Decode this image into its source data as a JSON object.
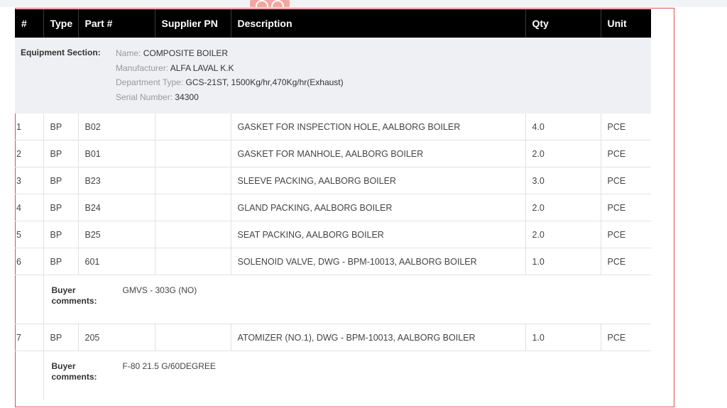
{
  "table": {
    "headers": [
      "#",
      "Type",
      "Part #",
      "Supplier PN",
      "Description",
      "Qty",
      "Unit"
    ],
    "equipment": {
      "label": "Equipment Section:",
      "name_key": "Name:",
      "name": "COMPOSITE BOILER",
      "manufacturer_key": "Manufacturer:",
      "manufacturer": "ALFA LAVAL K.K",
      "dept_key": "Department Type:",
      "dept": "GCS-21ST, 1500Kg/hr,470Kg/hr(Exhaust)",
      "serial_key": "Serial Number:",
      "serial": "34300"
    },
    "rows": [
      {
        "num": "1",
        "type": "BP",
        "part": "B02",
        "supplier_pn": "",
        "description": "GASKET FOR INSPECTION HOLE, AALBORG BOILER",
        "qty": "4.0",
        "unit": "PCE"
      },
      {
        "num": "2",
        "type": "BP",
        "part": "B01",
        "supplier_pn": "",
        "description": "GASKET FOR MANHOLE, AALBORG BOILER",
        "qty": "2.0",
        "unit": "PCE"
      },
      {
        "num": "3",
        "type": "BP",
        "part": "B23",
        "supplier_pn": "",
        "description": "SLEEVE PACKING, AALBORG BOILER",
        "qty": "3.0",
        "unit": "PCE"
      },
      {
        "num": "4",
        "type": "BP",
        "part": "B24",
        "supplier_pn": "",
        "description": "GLAND PACKING, AALBORG BOILER",
        "qty": "2.0",
        "unit": "PCE"
      },
      {
        "num": "5",
        "type": "BP",
        "part": "B25",
        "supplier_pn": "",
        "description": "SEAT PACKING, AALBORG BOILER",
        "qty": "2.0",
        "unit": "PCE"
      },
      {
        "num": "6",
        "type": "BP",
        "part": "601",
        "supplier_pn": "",
        "description": "SOLENOID VALVE, DWG - BPM-10013, AALBORG BOILER",
        "qty": "1.0",
        "unit": "PCE"
      },
      {
        "num": "7",
        "type": "BP",
        "part": "205",
        "supplier_pn": "",
        "description": "ATOMIZER (NO.1), DWG - BPM-10013, AALBORG BOILER",
        "qty": "1.0",
        "unit": "PCE"
      }
    ],
    "comments": [
      {
        "label": "Buyer comments:",
        "text": "GMVS - 303G (NO)"
      },
      {
        "label": "Buyer comments:",
        "text": "F-80 21.5 G/60DEGREE"
      }
    ]
  },
  "colors": {
    "header_bg": "#000000",
    "equipment_bg": "#eef0f3",
    "frame_border": "#d9534f"
  }
}
